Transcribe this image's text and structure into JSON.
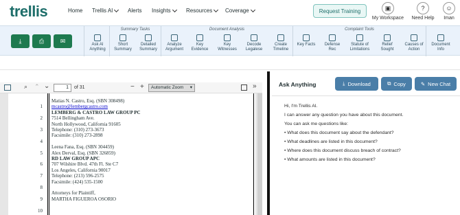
{
  "logo": "trellis",
  "nav": [
    "Home",
    "Trellis AI",
    "Alerts",
    "Insights",
    "Resources",
    "Coverage"
  ],
  "request_training": "Request Training",
  "top_icons": {
    "workspace": "My Workspace",
    "help": "Need Help",
    "user": "Iman"
  },
  "toolbar": {
    "summary_tasks": "Summary Tasks",
    "document_analysis": "Document Analysis",
    "complaint_tools": "Complaint Tools",
    "ask_ai": [
      "Ask AI",
      "Anything"
    ],
    "short_summary": [
      "Short",
      "Summary"
    ],
    "detailed_summary": [
      "Detailed",
      "Summary"
    ],
    "analyze_argument": [
      "Analyze",
      "Argument"
    ],
    "key_evidence": [
      "Key",
      "Evidence"
    ],
    "key_witnesses": [
      "Key",
      "Witnesses"
    ],
    "decode_legalese": [
      "Decode",
      "Legalese"
    ],
    "create_timeline": [
      "Create",
      "Timeline"
    ],
    "key_facts": [
      "Key Facts",
      ""
    ],
    "defense_rec": [
      "Defense",
      "Rec"
    ],
    "statute_limitations": [
      "Statute of",
      "Limitations"
    ],
    "relief_sought": [
      "Relief",
      "Sought"
    ],
    "causes_action": [
      "Causes of",
      "Action"
    ],
    "document_info": [
      "Document",
      "Info"
    ]
  },
  "pdf": {
    "page_number": "1",
    "page_total": "of 31",
    "zoom": "Automatic Zoom",
    "lines": [
      {
        "n": "",
        "t": "Matias N. Castro, Esq. (SBN 308498)"
      },
      {
        "n": "1",
        "t": "mcastro@lembergcastro.com"
      },
      {
        "n": "",
        "t": "LEMBERG & CASTRO LAW GROUP PC"
      },
      {
        "n": "2",
        "t": "7514 Bellingham Ave."
      },
      {
        "n": "",
        "t": "North Hollywood, California 91605"
      },
      {
        "n": "3",
        "t": "Telephone: (310) 273-3673"
      },
      {
        "n": "",
        "t": "Facsimile: (310) 273-2898"
      },
      {
        "n": "4",
        "t": ""
      },
      {
        "n": "",
        "t": "Leena Fana, Esq. (SBN 304459)"
      },
      {
        "n": "5",
        "t": "Alex Derval, Esq. (SBN 326859)"
      },
      {
        "n": "",
        "t": "RD LAW GROUP APC"
      },
      {
        "n": "6",
        "t": "707 Wilshire Blvd. 47th Fl. Ste C7"
      },
      {
        "n": "",
        "t": "Los Angeles, California 90017"
      },
      {
        "n": "7",
        "t": "Telephone: (213) 596-2575"
      },
      {
        "n": "",
        "t": "Facsimile: (424) 535-1500"
      },
      {
        "n": "8",
        "t": ""
      },
      {
        "n": "",
        "t": "Attorneys for Plaintiff,"
      },
      {
        "n": "9",
        "t": "MARTHA FIGUEROA OSORIO"
      },
      {
        "n": "",
        "t": ""
      },
      {
        "n": "10",
        "t": ""
      }
    ]
  },
  "ask": {
    "title": "Ask Anything",
    "download": "Download",
    "copy": "Copy",
    "new_chat": "New Chat",
    "messages": [
      "Hi, I'm Trellis AI.",
      "I can answer any question you have about this document.",
      "You can ask me questions like:",
      "• What does this document say about the defendant?",
      "• What deadlines are listed in this document?",
      "• Where does this document discuss breach of contract?",
      "• What amounts are listed in this document?"
    ]
  },
  "colors": {
    "brand": "#1e6e6a",
    "green": "#1e7a4f",
    "toolbar_bg": "#eaf2fb",
    "button_blue": "#4a7ea8"
  }
}
